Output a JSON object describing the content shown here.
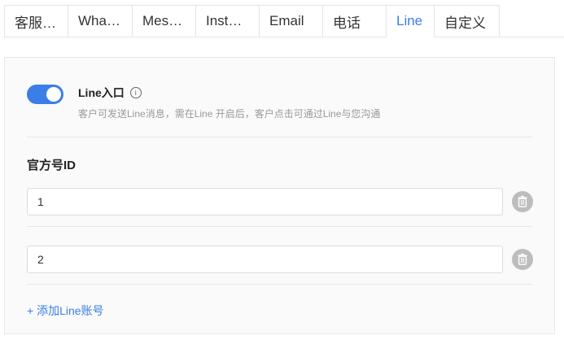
{
  "tabs": [
    {
      "label": "客服…",
      "active": false
    },
    {
      "label": "Wha…",
      "active": false
    },
    {
      "label": "Mes…",
      "active": false
    },
    {
      "label": "Inst…",
      "active": false
    },
    {
      "label": "Email",
      "active": false
    },
    {
      "label": "电话",
      "active": false
    },
    {
      "label": "Line",
      "active": true
    },
    {
      "label": "自定义",
      "active": false
    }
  ],
  "entry": {
    "enabled": true,
    "title": "Line入口",
    "info_icon": "info-icon",
    "description": "客户可发送Line消息，需在Line 开启后，客户点击可通过Line与您沟通"
  },
  "official_ids": {
    "title": "官方号ID",
    "items": [
      {
        "value": "1",
        "delete_icon": "trash-icon"
      },
      {
        "value": "2",
        "delete_icon": "trash-icon"
      }
    ],
    "add_label": "+ 添加Line账号"
  },
  "colors": {
    "accent": "#3a7ee6",
    "delete_button": "#bdbdbd"
  }
}
